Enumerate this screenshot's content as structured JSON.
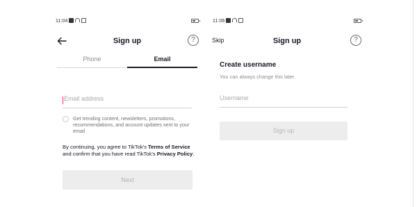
{
  "left_screen": {
    "status_time": "11:04",
    "title": "Sign up",
    "help_label": "?",
    "tabs": [
      {
        "label": "Phone",
        "active": false
      },
      {
        "label": "Email",
        "active": true
      }
    ],
    "email_placeholder": "Email address",
    "email_value": "",
    "opt_in_text": "Get trending content, newsletters, promotions, recommendations, and account updates sent to your email",
    "opt_in_checked": false,
    "legal": {
      "prefix": "By continuing, you agree to TikTok's ",
      "terms_link": "Terms of Service",
      "middle": " and confirm that you have read TikTok's ",
      "privacy_link": "Privacy Policy",
      "suffix": "."
    },
    "next_label": "Next"
  },
  "right_screen": {
    "status_time": "11:06",
    "skip_label": "Skip",
    "title": "Sign up",
    "help_label": "?",
    "heading": "Create username",
    "subheading": "You can always change this later.",
    "username_placeholder": "Username",
    "username_value": "",
    "signup_label": "Sign up"
  },
  "colors": {
    "text_primary": "#161823",
    "text_secondary": "#8a8b91",
    "accent_caret": "#fe2c55",
    "disabled_button_bg": "#ededed",
    "disabled_button_text": "#b4b5b9"
  },
  "icons": {
    "back": "arrow-left-icon",
    "help": "question-circle-icon",
    "battery": "battery-icon",
    "wifi": "wifi-icon"
  }
}
